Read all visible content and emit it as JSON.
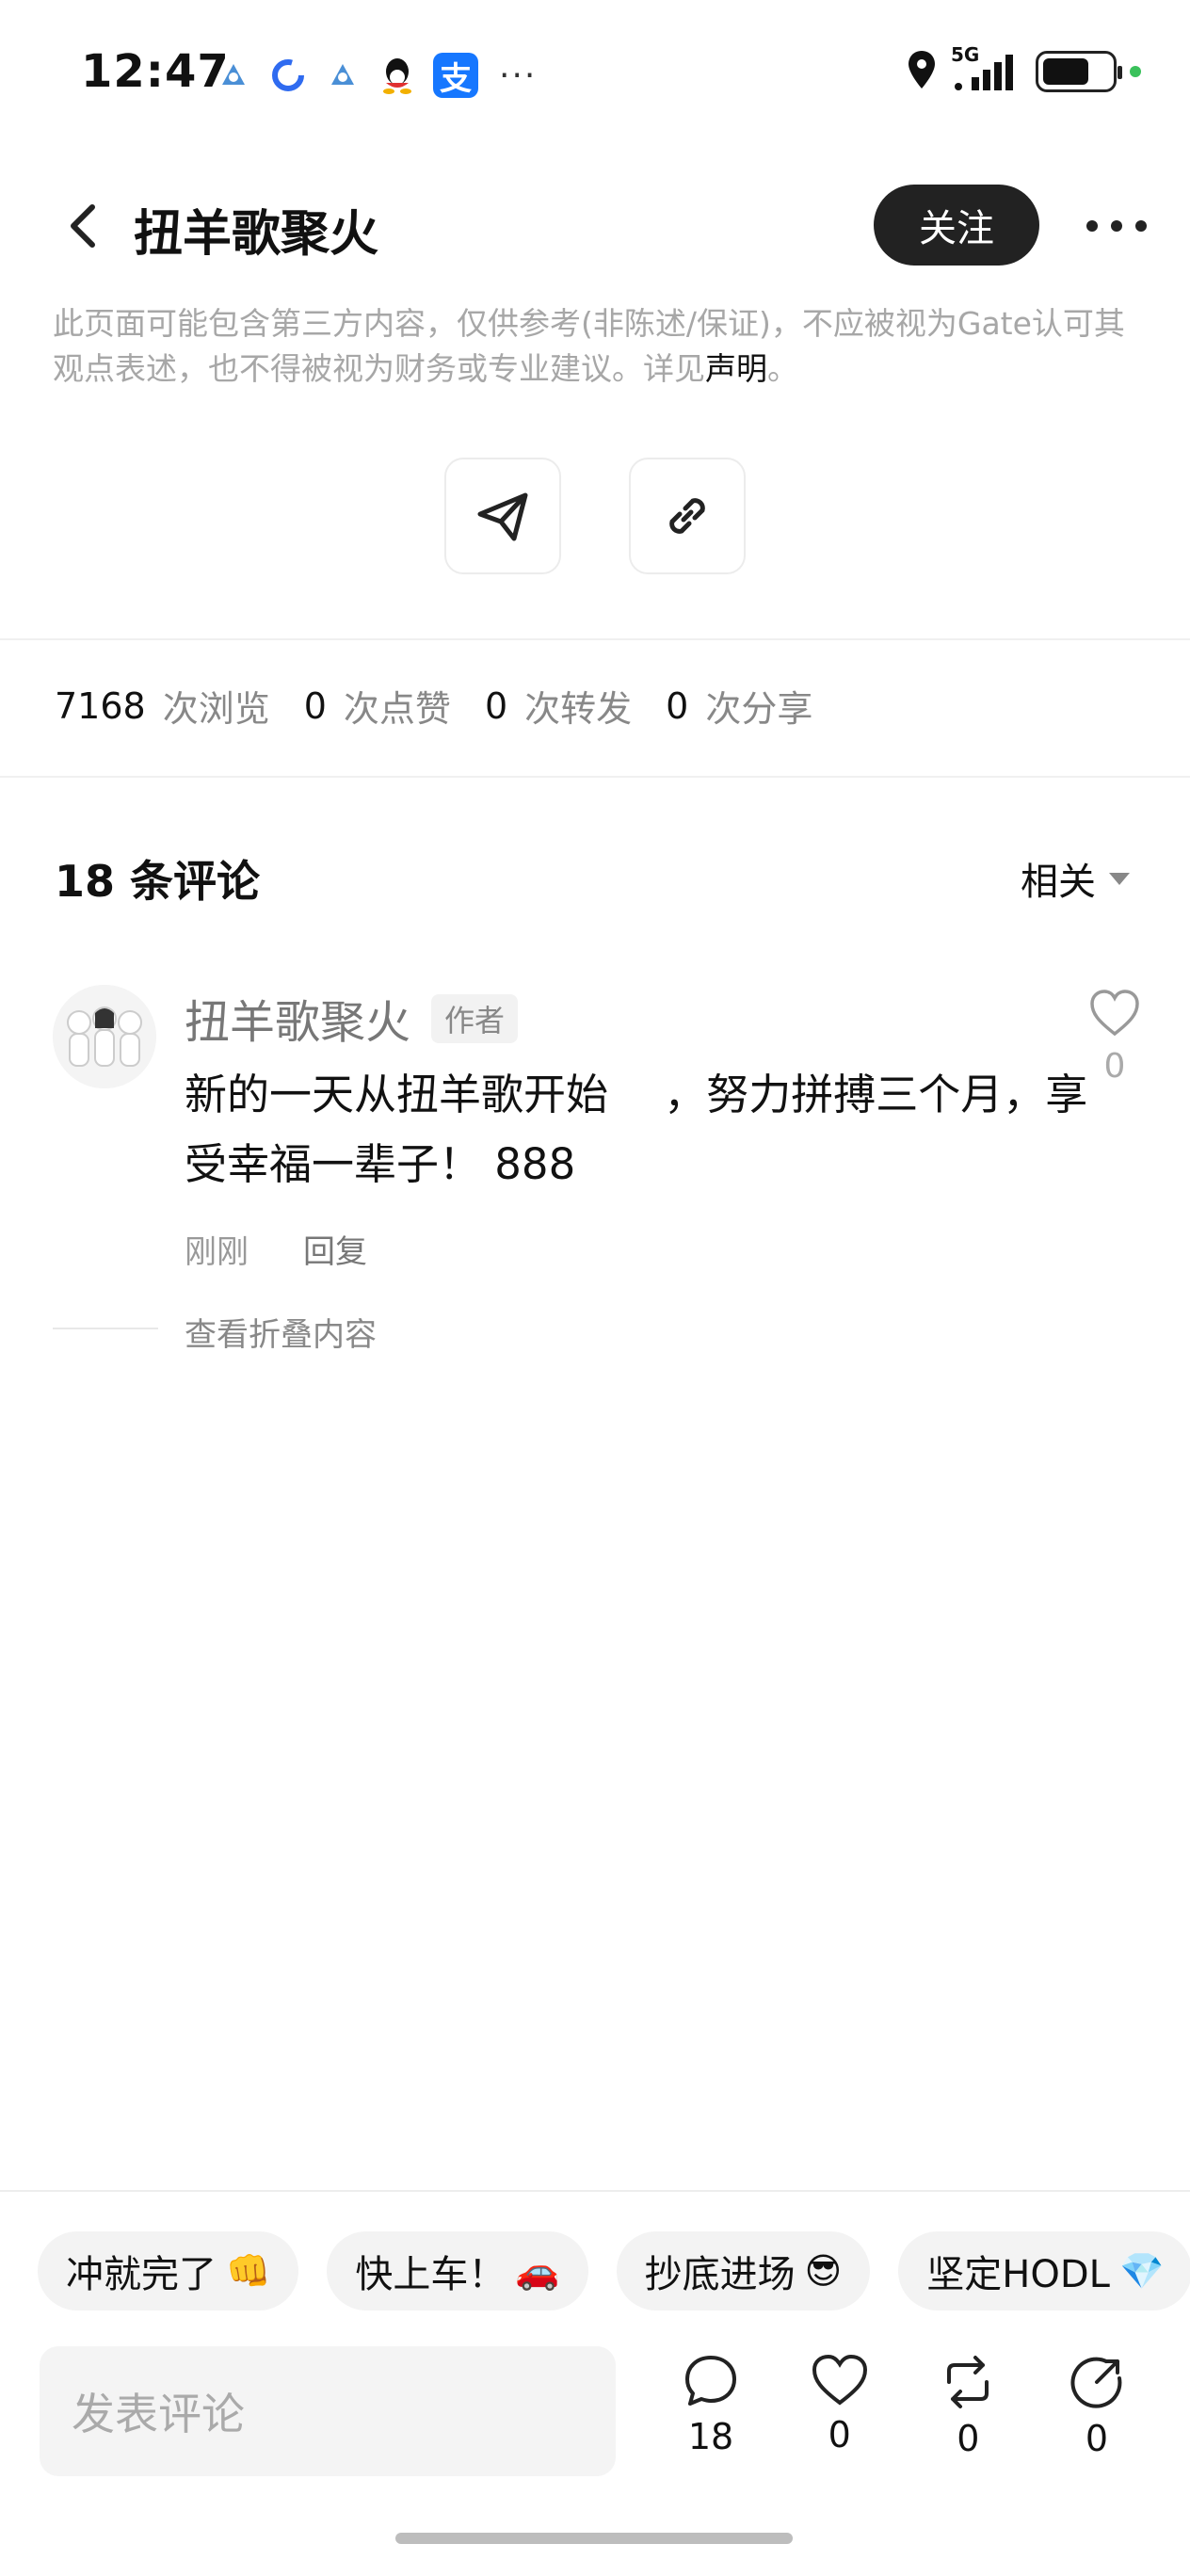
{
  "status_bar": {
    "time": "12:47",
    "network": "5G",
    "app_icons": [
      "google-ads-icon",
      "loop-icon",
      "google-ads-icon",
      "qq-icon",
      "alipay-icon",
      "more-dots-icon"
    ],
    "alipay_glyph": "支",
    "more": "···"
  },
  "header": {
    "title": "扭羊歌聚火",
    "follow_label": "关注"
  },
  "disclaimer": {
    "text": "此页面可能包含第三方内容，仅供参考(非陈述/保证)，不应被视为Gate认可其观点表述，也不得被视为财务或专业建议。详见",
    "link": "声明",
    "end": "。"
  },
  "share": {
    "items": [
      "send-icon",
      "link-icon"
    ]
  },
  "stats": {
    "views": "7168",
    "views_label": "次浏览",
    "likes": "0",
    "likes_label": "次点赞",
    "reposts": "0",
    "reposts_label": "次转发",
    "shares": "0",
    "shares_label": "次分享"
  },
  "comments": {
    "heading": "18 条评论",
    "sort_label": "相关",
    "items": [
      {
        "author": "扭羊歌聚火",
        "badge": "作者",
        "text": "新的一天从扭羊歌开始　 ，努力拼搏三个月，享受幸福一辈子！ 888",
        "time": "刚刚",
        "reply": "回复",
        "likes": "0"
      }
    ],
    "fold_text": "查看折叠内容"
  },
  "quick_replies": [
    {
      "label": "冲就完了",
      "emoji": "👊"
    },
    {
      "label": "快上车！",
      "emoji": "🚗"
    },
    {
      "label": "抄底进场",
      "emoji": "😎"
    },
    {
      "label": "坚定HODL",
      "emoji": "💎"
    }
  ],
  "bottom_bar": {
    "input_placeholder": "发表评论",
    "comment_count": "18",
    "like_count": "0",
    "repost_count": "0",
    "share_count": "0"
  },
  "colors": {
    "follow_bg": "#222222",
    "muted_text": "#a7a7a7",
    "chip_bg": "#f3f3f3",
    "alipay_blue": "#1677ff"
  }
}
